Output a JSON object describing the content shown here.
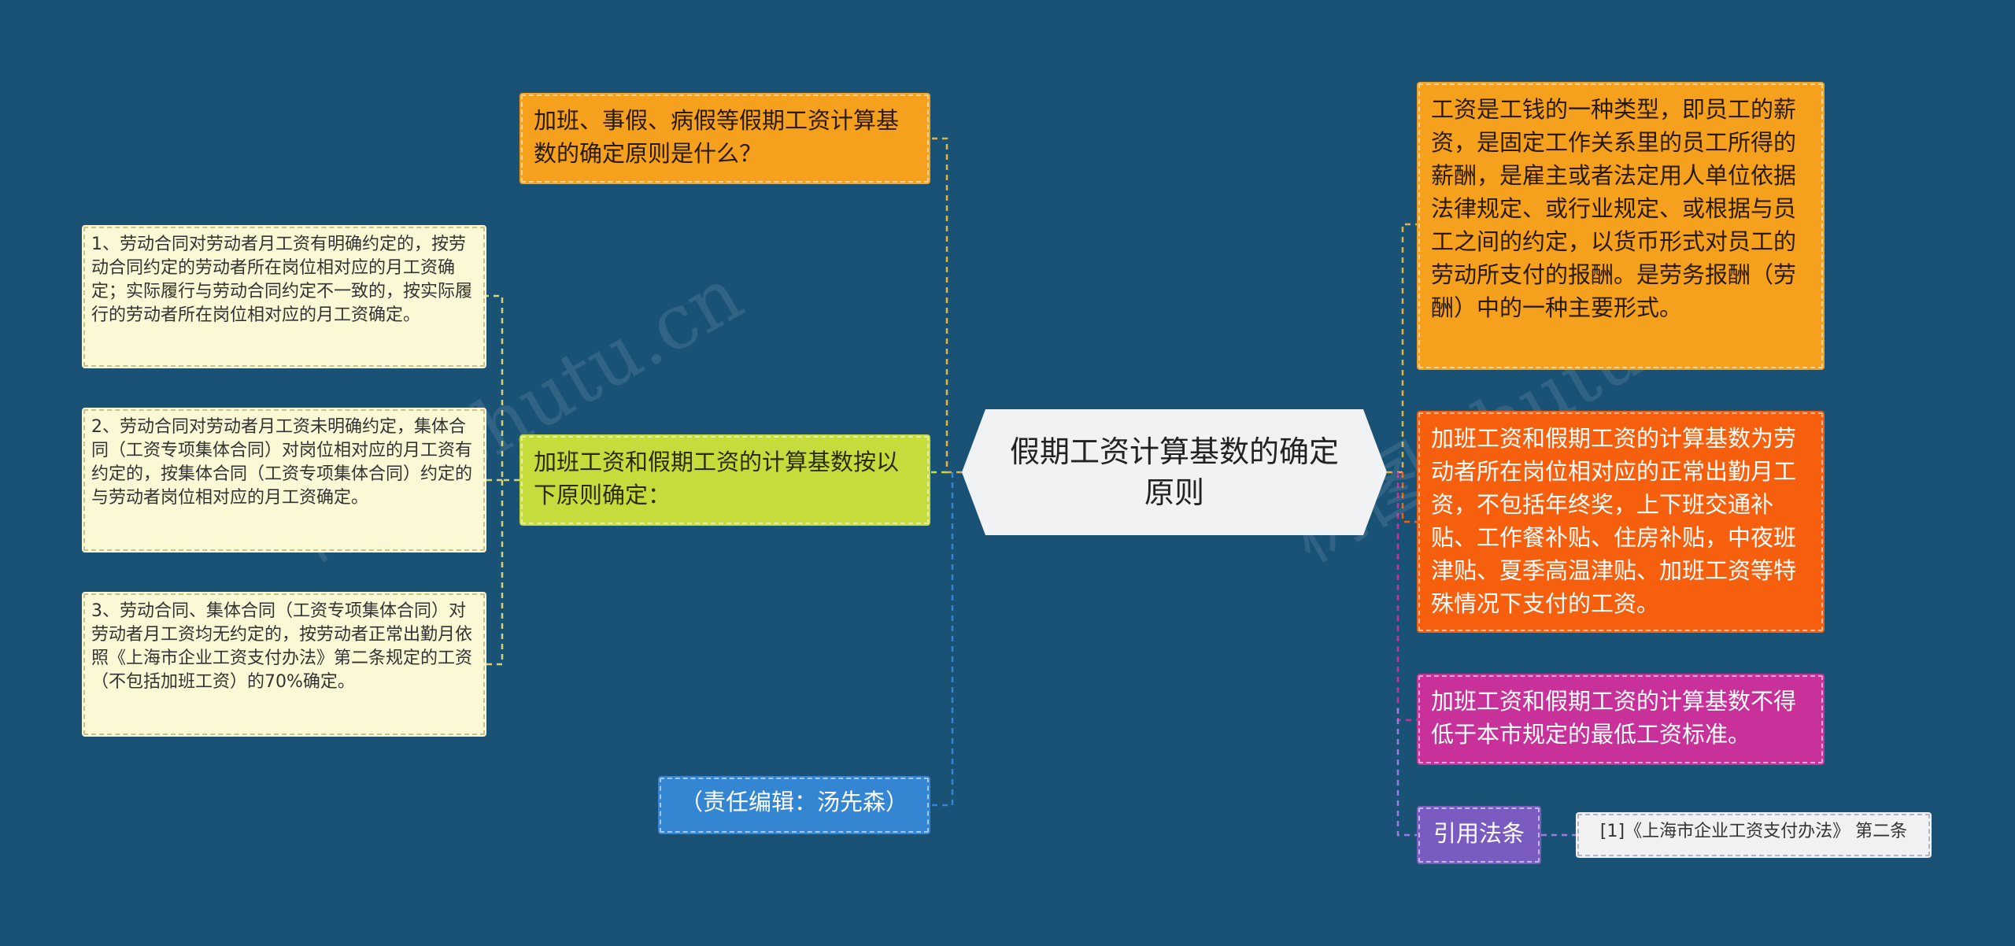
{
  "root": {
    "title": "假期工资计算基数的确定原则"
  },
  "left": {
    "question": "加班、事假、病假等假期工资计算基数的确定原则是什么？",
    "principle": "加班工资和假期工资的计算基数按以下原则确定：",
    "sub_items": [
      "1、劳动合同对劳动者月工资有明确约定的，按劳动合同约定的劳动者所在岗位相对应的月工资确定；实际履行与劳动合同约定不一致的，按实际履行的劳动者所在岗位相对应的月工资确定。",
      "2、劳动合同对劳动者月工资未明确约定，集体合同（工资专项集体合同）对岗位相对应的月工资有约定的，按集体合同（工资专项集体合同）约定的与劳动者岗位相对应的月工资确定。",
      "3、劳动合同、集体合同（工资专项集体合同）对劳动者月工资均无约定的，按劳动者正常出勤月依照《上海市企业工资支付办法》第二条规定的工资（不包括加班工资）的70%确定。"
    ],
    "editor": "（责任编辑：汤先森）"
  },
  "right": {
    "wage_def": "工资是工钱的一种类型，即员工的薪资，是固定工作关系里的员工所得的薪酬，是雇主或者法定用人单位依据法律规定、或行业规定、或根据与员工之间的约定，以货币形式对员工的劳动所支付的报酬。是劳务报酬（劳酬）中的一种主要形式。",
    "base_def": "加班工资和假期工资的计算基数为劳动者所在岗位相对应的正常出勤月工资，不包括年终奖，上下班交通补贴、工作餐补贴、住房补贴，中夜班津贴、夏季高温津贴、加班工资等特殊情况下支付的工资。",
    "min_rule": "加班工资和假期工资的计算基数不得低于本市规定的最低工资标准。",
    "law_label": "引用法条",
    "law_ref": "[1]《上海市企业工资支付办法》 第二条"
  },
  "colors": {
    "background": "#1a5276",
    "orange": "#f5a11d",
    "red": "#f65f0d",
    "magenta": "#c8309a",
    "lime": "#c6dc3c",
    "blue": "#3485d2",
    "purple": "#7a5cc1",
    "cream": "#fbf8d6",
    "root": "#f1f2f4"
  },
  "watermark": "树图 shutu.cn"
}
